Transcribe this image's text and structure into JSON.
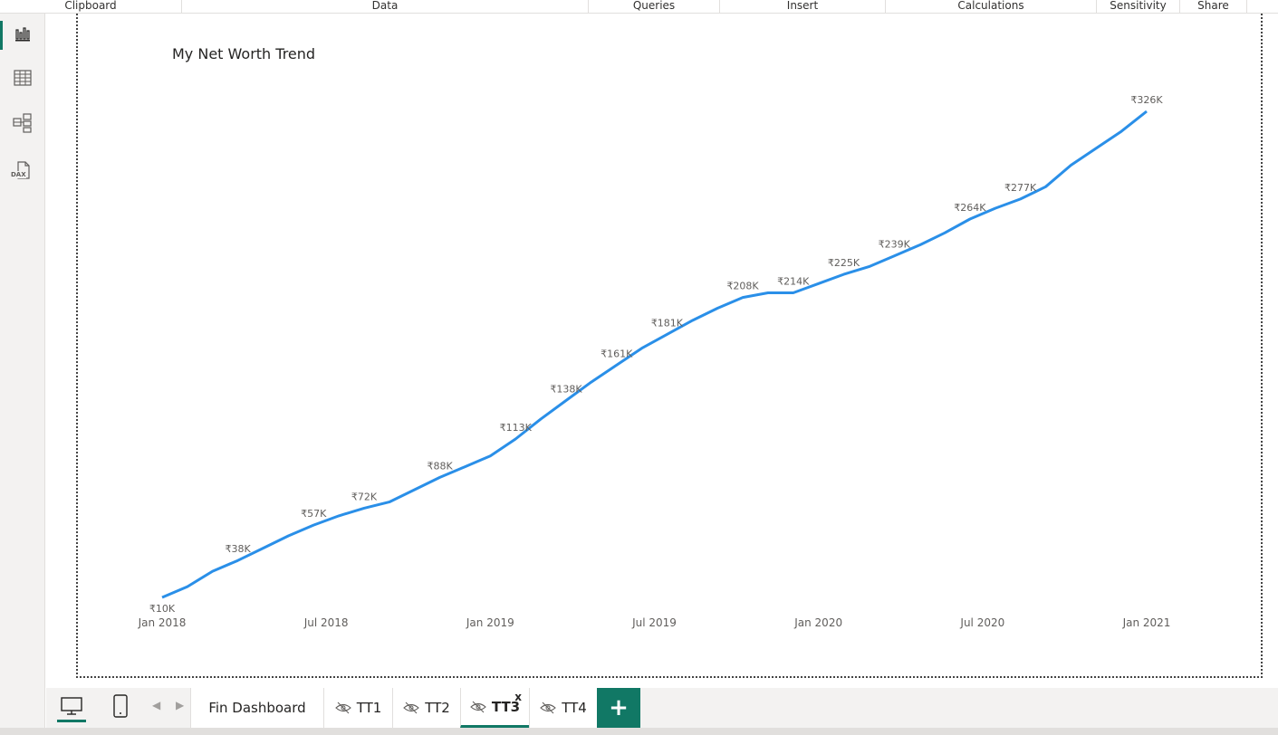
{
  "ribbon": {
    "groups": [
      "Clipboard",
      "Data",
      "Queries",
      "Insert",
      "Calculations",
      "Sensitivity",
      "Share"
    ]
  },
  "rail": {
    "icons": [
      "report-view-icon",
      "table-view-icon",
      "model-view-icon",
      "dax-query-view-icon"
    ],
    "dax_label": "DAX"
  },
  "chart_data": {
    "type": "line",
    "title": "My Net Worth Trend",
    "xlabel": "",
    "ylabel": "",
    "x_ticks": [
      "Jan 2018",
      "Jul 2018",
      "Jan 2019",
      "Jul 2019",
      "Jan 2020",
      "Jul 2020",
      "Jan 2021"
    ],
    "x": [
      "2018-01",
      "2018-02",
      "2018-03",
      "2018-04",
      "2018-05",
      "2018-06",
      "2018-07",
      "2018-08",
      "2018-09",
      "2018-10",
      "2018-11",
      "2018-12",
      "2019-01",
      "2019-02",
      "2019-03",
      "2019-04",
      "2019-05",
      "2019-06",
      "2019-07",
      "2019-08",
      "2019-09",
      "2019-10",
      "2019-11",
      "2019-12",
      "2020-01",
      "2020-02",
      "2020-03",
      "2020-04",
      "2020-05",
      "2020-06",
      "2020-07",
      "2020-08",
      "2020-09",
      "2020-10",
      "2020-11",
      "2020-12",
      "2021-01"
    ],
    "series": [
      {
        "values": [
          10,
          17,
          27,
          34,
          42,
          50,
          57,
          63,
          68,
          72,
          80,
          88,
          95,
          102,
          113,
          126,
          138,
          150,
          161,
          172,
          181,
          190,
          198,
          205,
          208,
          208,
          214,
          220,
          225,
          232,
          239,
          247,
          256,
          263,
          269,
          277,
          291,
          302,
          313,
          326
        ],
        "color": "#2a8fe8"
      }
    ],
    "data_labels": [
      {
        "index": 0,
        "text": "₹10K"
      },
      {
        "index": 3,
        "text": "₹38K"
      },
      {
        "index": 6,
        "text": "₹57K"
      },
      {
        "index": 8,
        "text": "₹72K"
      },
      {
        "index": 11,
        "text": "₹88K"
      },
      {
        "index": 14,
        "text": "₹113K"
      },
      {
        "index": 16,
        "text": "₹138K"
      },
      {
        "index": 18,
        "text": "₹161K"
      },
      {
        "index": 20,
        "text": "₹181K"
      },
      {
        "index": 23,
        "text": "₹208K"
      },
      {
        "index": 25,
        "text": "₹214K"
      },
      {
        "index": 27,
        "text": "₹225K"
      },
      {
        "index": 29,
        "text": "₹239K"
      },
      {
        "index": 32,
        "text": "₹264K"
      },
      {
        "index": 34,
        "text": "₹277K"
      },
      {
        "index": 39,
        "text": "₹326K"
      }
    ],
    "ylim": [
      10,
      326
    ],
    "grid": false,
    "legend": "none"
  },
  "tabs": {
    "pages": [
      {
        "label": "Fin Dashboard",
        "hidden": false,
        "active": false
      },
      {
        "label": "TT1",
        "hidden": true,
        "active": false
      },
      {
        "label": "TT2",
        "hidden": true,
        "active": false
      },
      {
        "label": "TT3",
        "hidden": true,
        "active": true
      },
      {
        "label": "TT4",
        "hidden": true,
        "active": false
      }
    ],
    "close_label": "x",
    "add_label": "+"
  },
  "colors": {
    "accent": "#117865",
    "line": "#2a8fe8"
  }
}
